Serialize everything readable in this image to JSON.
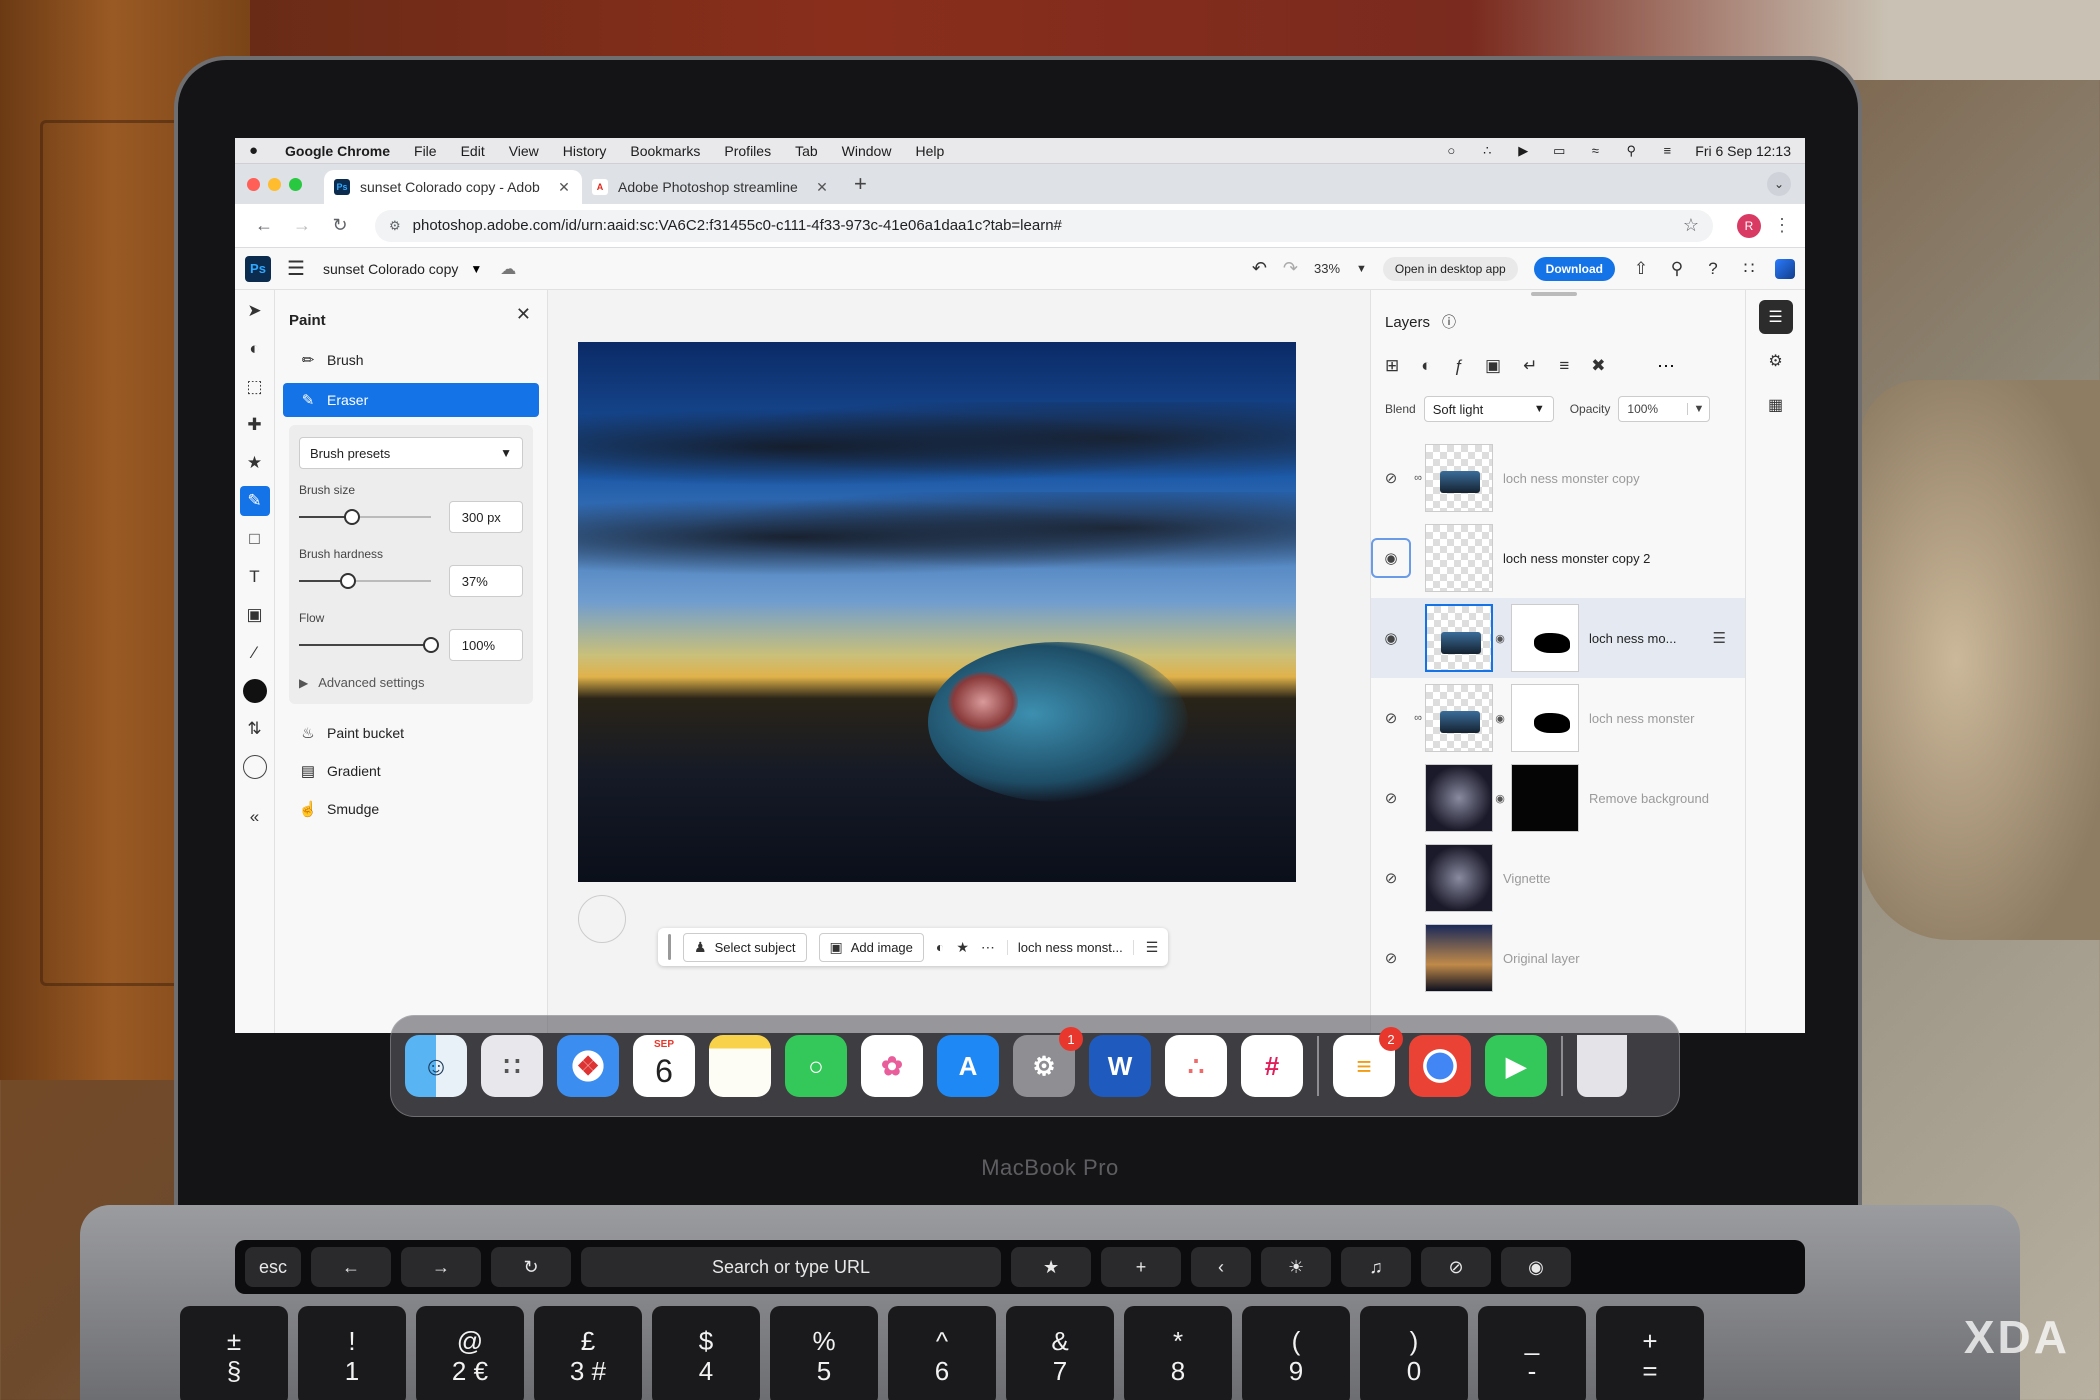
{
  "menubar": {
    "app": "Google Chrome",
    "items": [
      "File",
      "Edit",
      "View",
      "History",
      "Bookmarks",
      "Profiles",
      "Tab",
      "Window",
      "Help"
    ],
    "clock": "Fri 6 Sep  12:13"
  },
  "tabs": [
    {
      "title": "sunset Colorado copy - Adob",
      "favicon": "Ps",
      "active": true
    },
    {
      "title": "Adobe Photoshop streamline",
      "favicon": "A",
      "active": false
    }
  ],
  "toolbar": {
    "url": "photoshop.adobe.com/id/urn:aaid:sc:VA6C2:f31455c0-c111-4f33-973c-41e06a1daa1c?tab=learn#",
    "profile_initial": "R"
  },
  "ps_header": {
    "logo": "Ps",
    "doc_name": "sunset Colorado copy",
    "zoom": "33%",
    "open_desktop": "Open in desktop app",
    "download": "Download"
  },
  "paint_panel": {
    "title": "Paint",
    "items": [
      "Brush",
      "Eraser"
    ],
    "preset_label": "Brush presets",
    "controls": [
      {
        "label": "Brush size",
        "value": "300 px",
        "level": 0.4
      },
      {
        "label": "Brush hardness",
        "value": "37%",
        "level": 0.37
      },
      {
        "label": "Flow",
        "value": "100%",
        "level": 1.0
      }
    ],
    "advanced": "Advanced settings",
    "tools": [
      "Paint bucket",
      "Gradient",
      "Smudge"
    ]
  },
  "taskbar": {
    "select_subject": "Select subject",
    "add_image": "Add image",
    "layer_name": "loch ness monst..."
  },
  "layers_panel": {
    "title": "Layers",
    "blend_label": "Blend",
    "blend_mode": "Soft light",
    "opacity_label": "Opacity",
    "opacity": "100%",
    "layers": [
      {
        "name": "loch ness monster copy",
        "visible": false
      },
      {
        "name": "loch ness monster copy 2",
        "visible": true
      },
      {
        "name": "loch ness mo...",
        "visible": true,
        "selected": true
      },
      {
        "name": "loch ness monster",
        "visible": false
      },
      {
        "name": "Remove background",
        "visible": false
      },
      {
        "name": "Vignette",
        "visible": false
      },
      {
        "name": "Original layer",
        "visible": false
      }
    ]
  },
  "dock": {
    "calendar_month": "SEP",
    "calendar_day": "6",
    "settings_badge": "1",
    "reminders_badge": "2",
    "word_letter": "W"
  },
  "hardware": {
    "model_label": "MacBook Pro",
    "touchbar_search": "Search or type URL",
    "esc": "esc",
    "keys": [
      {
        "top": "±",
        "bottom": "§"
      },
      {
        "top": "!",
        "bottom": "1"
      },
      {
        "top": "@",
        "bottom": "2 €"
      },
      {
        "top": "£",
        "bottom": "3 #"
      },
      {
        "top": "$",
        "bottom": "4"
      },
      {
        "top": "%",
        "bottom": "5"
      },
      {
        "top": "^",
        "bottom": "6"
      },
      {
        "top": "&",
        "bottom": "7"
      },
      {
        "top": "*",
        "bottom": "8"
      },
      {
        "top": "(",
        "bottom": "9"
      },
      {
        "top": ")",
        "bottom": "0"
      },
      {
        "top": "_",
        "bottom": "-"
      },
      {
        "top": "+",
        "bottom": "="
      }
    ]
  },
  "watermark": "XDA",
  "colors": {
    "accent": "#1473e6",
    "ps_logo_bg": "#0b2c4e"
  }
}
